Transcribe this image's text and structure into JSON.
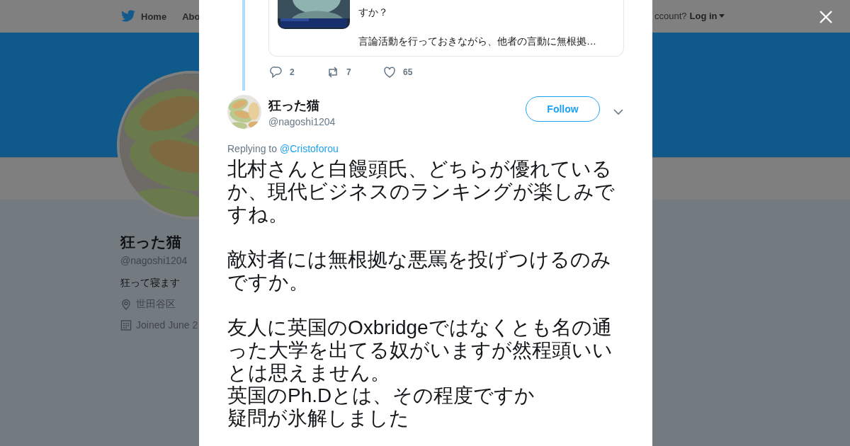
{
  "nav": {
    "items": [
      {
        "label": "Home",
        "kind": "home"
      },
      {
        "label": "Abo",
        "kind": "plain"
      }
    ],
    "account_prompt": "ccount?",
    "login": "Log in"
  },
  "profile": {
    "name": "狂った猫",
    "handle": "@nagoshi1204",
    "bio": "狂って寝ます",
    "location": "世田谷区",
    "joined": "Joined June 2"
  },
  "modal": {
    "quoted": {
      "paragraphs": [
        "すか？",
        "言論活動を行っておきながら、他者の言動に無根拠…"
      ],
      "image": {
        "kind": "picture"
      }
    },
    "parent_actions": [
      {
        "kind": "reply",
        "count": "2"
      },
      {
        "kind": "retweet",
        "count": "7"
      },
      {
        "kind": "like",
        "count": "65"
      }
    ],
    "tweet": {
      "name": "狂った猫",
      "handle": "@nagoshi1204",
      "follow": "Follow",
      "replying_prefix": "Replying to",
      "replying_to": "@Cristoforou",
      "paragraphs": [
        [
          "北村さんと白饅頭氏、どちらが優れているか、現代ビジネスのランキングが楽しみですね。"
        ],
        [
          "敵対者には無根拠な悪罵を投げつけるのみですか。"
        ],
        [
          "友人に英国のOxbridgeではなくとも名の通った大学を出てる奴がいますが然程頭いいとは思えません。",
          "英国のPh.Dとは、その程度ですか",
          "疑問が氷解しました"
        ]
      ]
    }
  }
}
